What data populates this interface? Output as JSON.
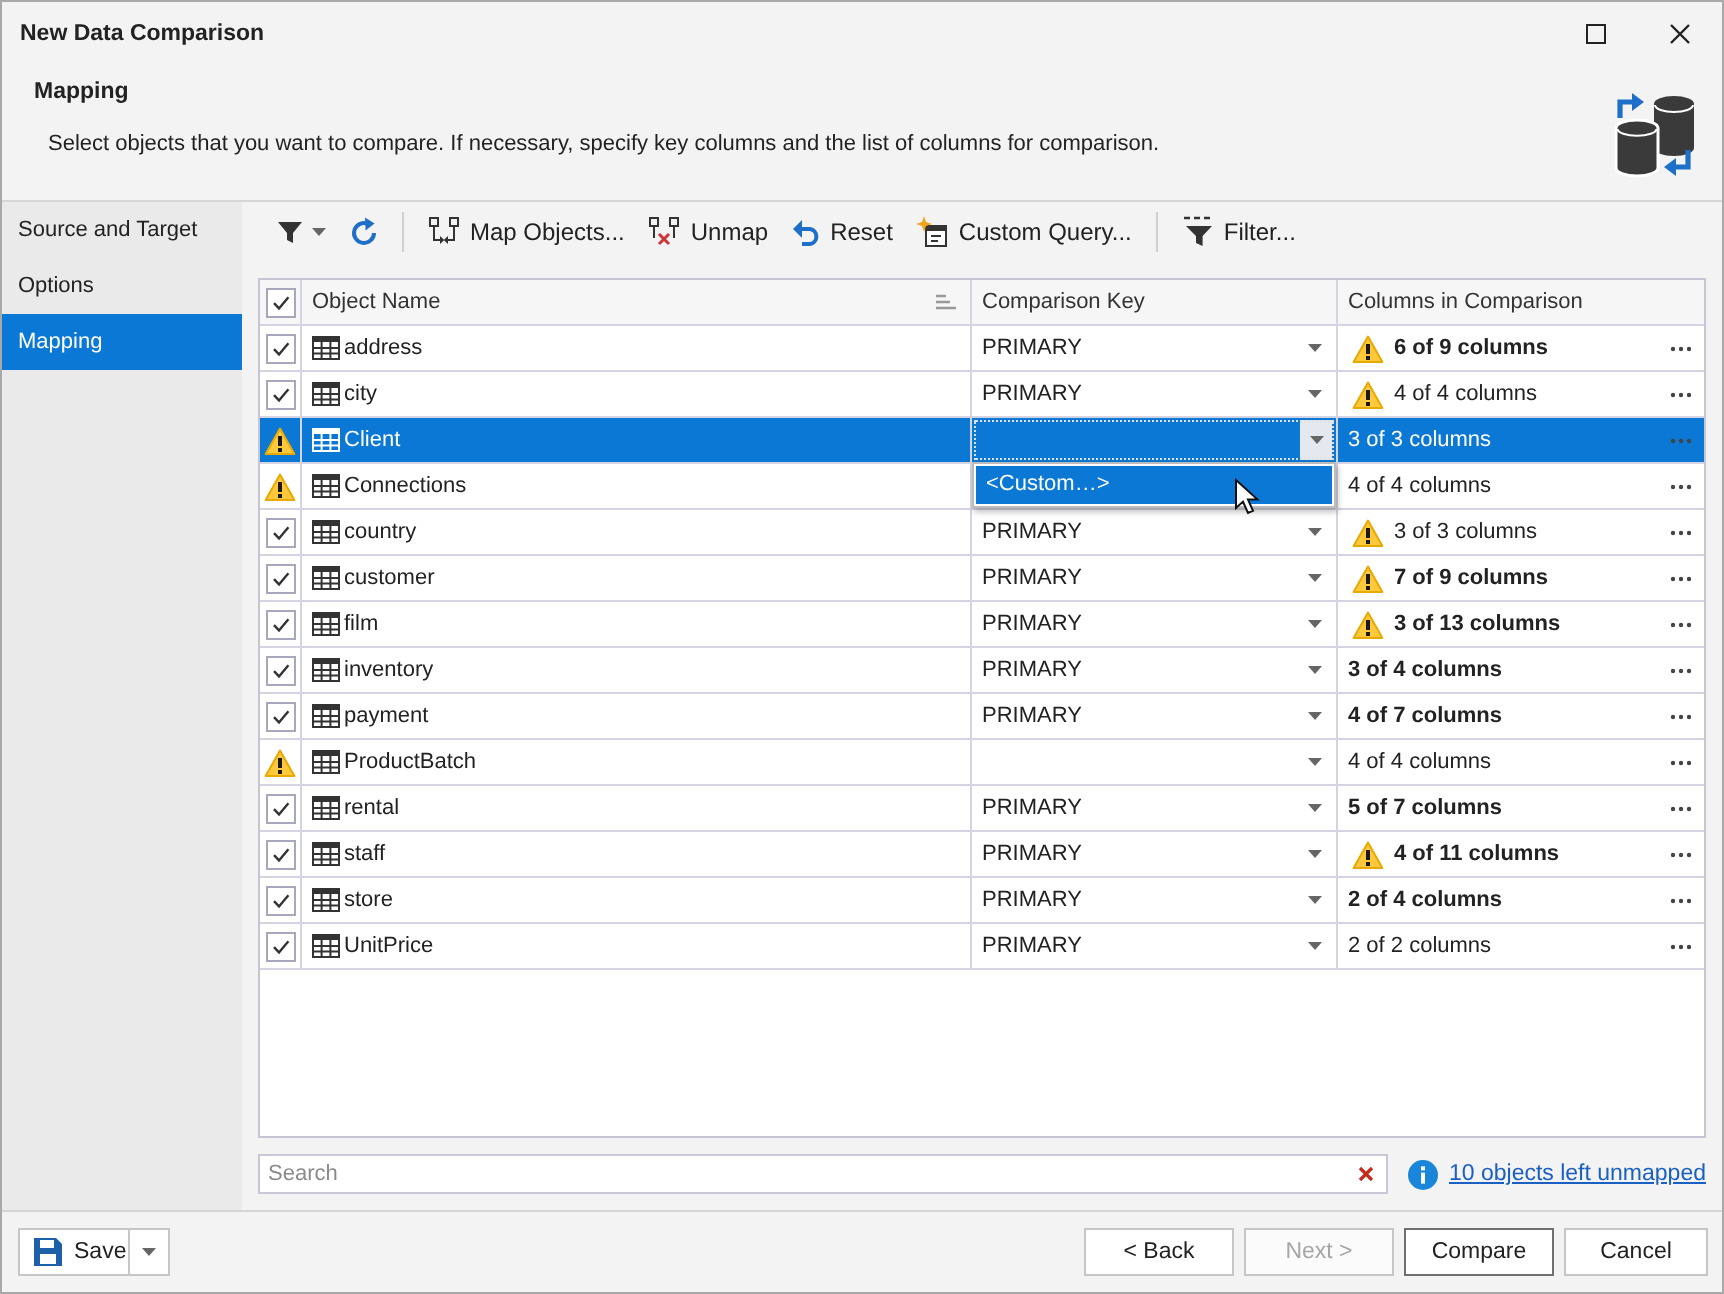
{
  "window": {
    "title": "New Data Comparison"
  },
  "header": {
    "title": "Mapping",
    "description": "Select objects that you want to compare. If necessary, specify key columns and the list of columns for comparison."
  },
  "sidebar": {
    "items": [
      {
        "label": "Source and Target",
        "selected": false
      },
      {
        "label": "Options",
        "selected": false
      },
      {
        "label": "Mapping",
        "selected": true
      }
    ]
  },
  "toolbar": {
    "items": [
      {
        "kind": "filter"
      },
      {
        "kind": "refresh"
      },
      {
        "kind": "separator"
      },
      {
        "kind": "map",
        "label": "Map Objects..."
      },
      {
        "kind": "unmap",
        "label": "Unmap"
      },
      {
        "kind": "reset",
        "label": "Reset"
      },
      {
        "kind": "query",
        "label": "Custom Query..."
      },
      {
        "kind": "separator"
      },
      {
        "kind": "sql_filter",
        "label": "Filter..."
      }
    ]
  },
  "table": {
    "all_checked": true,
    "columns": [
      "Object Name",
      "Comparison Key",
      "Columns in Comparison"
    ],
    "rows": [
      {
        "kind": "checkbox",
        "checked": true,
        "name": "address",
        "key": "PRIMARY",
        "columns": "6 of 9 columns",
        "warning": true,
        "bold": true,
        "selected": false
      },
      {
        "kind": "checkbox",
        "checked": true,
        "name": "city",
        "key": "PRIMARY",
        "columns": "4 of 4 columns",
        "warning": true,
        "bold": false,
        "selected": false
      },
      {
        "kind": "warning",
        "name": "Client",
        "columns": "3 of 3 columns",
        "warning": false,
        "bold": false,
        "selected": true,
        "dropdown": {
          "options": [
            {
              "label": "<Custom…>",
              "selected": true
            }
          ]
        }
      },
      {
        "kind": "warning",
        "name": "Connections",
        "columns": "4 of 4 columns",
        "warning": false,
        "bold": false,
        "selected": false
      },
      {
        "kind": "checkbox",
        "checked": true,
        "name": "country",
        "key": "PRIMARY",
        "columns": "3 of 3 columns",
        "warning": true,
        "bold": false,
        "selected": false
      },
      {
        "kind": "checkbox",
        "checked": true,
        "name": "customer",
        "key": "PRIMARY",
        "columns": "7 of 9 columns",
        "warning": true,
        "bold": true,
        "selected": false
      },
      {
        "kind": "checkbox",
        "checked": true,
        "name": "film",
        "key": "PRIMARY",
        "columns": "3 of 13 columns",
        "warning": true,
        "bold": true,
        "selected": false
      },
      {
        "kind": "checkbox",
        "checked": true,
        "name": "inventory",
        "key": "PRIMARY",
        "columns": "3 of 4 columns",
        "warning": false,
        "bold": true,
        "selected": false
      },
      {
        "kind": "checkbox",
        "checked": true,
        "name": "payment",
        "key": "PRIMARY",
        "columns": "4 of 7 columns",
        "warning": false,
        "bold": true,
        "selected": false
      },
      {
        "kind": "warning",
        "name": "ProductBatch",
        "columns": "4 of 4 columns",
        "warning": false,
        "bold": false,
        "selected": false
      },
      {
        "kind": "checkbox",
        "checked": true,
        "name": "rental",
        "key": "PRIMARY",
        "columns": "5 of 7 columns",
        "warning": false,
        "bold": true,
        "selected": false
      },
      {
        "kind": "checkbox",
        "checked": true,
        "name": "staff",
        "key": "PRIMARY",
        "columns": "4 of 11 columns",
        "warning": true,
        "bold": true,
        "selected": false
      },
      {
        "kind": "checkbox",
        "checked": true,
        "name": "store",
        "key": "PRIMARY",
        "columns": "2 of 4 columns",
        "warning": false,
        "bold": true,
        "selected": false
      },
      {
        "kind": "checkbox",
        "checked": true,
        "name": "UnitPrice",
        "key": "PRIMARY",
        "columns": "2 of 2 columns",
        "warning": false,
        "bold": false,
        "selected": false
      }
    ]
  },
  "search": {
    "placeholder": "Search"
  },
  "unmapped_link": "10 objects left unmapped",
  "footer": {
    "buttons": [
      {
        "kind": "save",
        "label": "Save",
        "disabled": false,
        "default": false
      },
      {
        "kind": "back",
        "label": "< Back",
        "disabled": false,
        "default": false
      },
      {
        "kind": "next",
        "label": "Next >",
        "disabled": true,
        "default": false
      },
      {
        "kind": "compare",
        "label": "Compare",
        "disabled": false,
        "default": true
      },
      {
        "kind": "cancel",
        "label": "Cancel",
        "disabled": false,
        "default": false
      }
    ]
  }
}
